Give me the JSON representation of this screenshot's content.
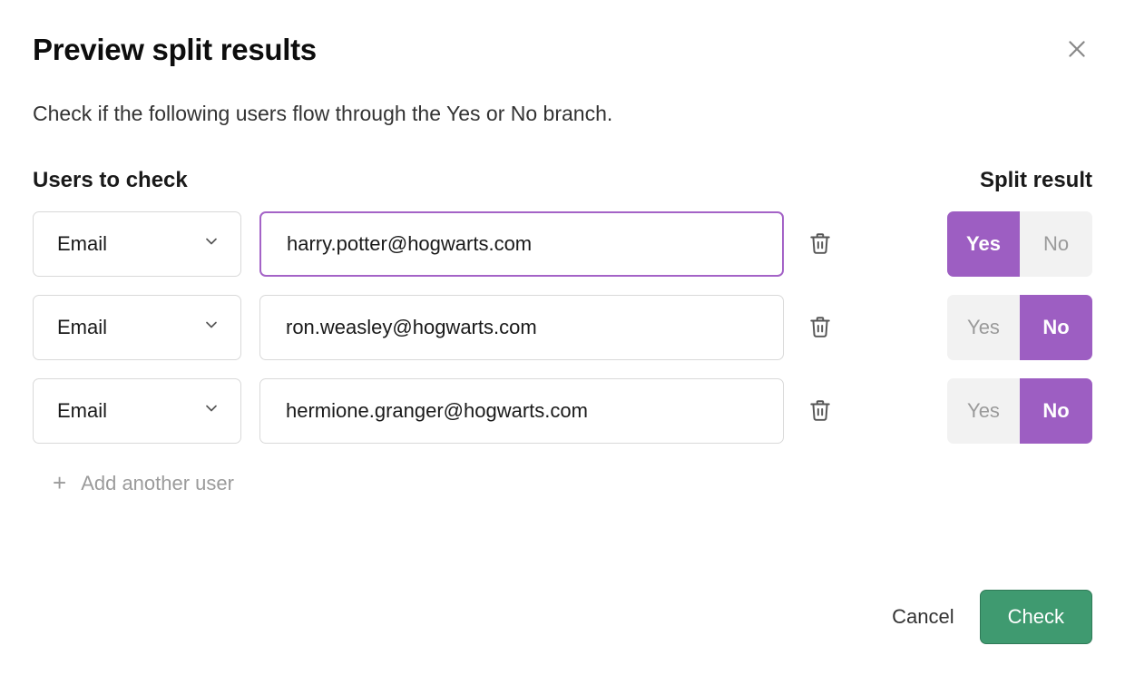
{
  "header": {
    "title": "Preview split results"
  },
  "subtitle": "Check if the following users flow through the Yes or No branch.",
  "labels": {
    "users_to_check": "Users to check",
    "split_result": "Split result"
  },
  "result_labels": {
    "yes": "Yes",
    "no": "No"
  },
  "rows": [
    {
      "type_label": "Email",
      "value": "harry.potter@hogwarts.com",
      "result": "yes",
      "focused": true
    },
    {
      "type_label": "Email",
      "value": "ron.weasley@hogwarts.com",
      "result": "no",
      "focused": false
    },
    {
      "type_label": "Email",
      "value": "hermione.granger@hogwarts.com",
      "result": "no",
      "focused": false
    }
  ],
  "add_user_label": "Add another user",
  "footer": {
    "cancel": "Cancel",
    "check": "Check"
  },
  "colors": {
    "accent_purple": "#9d5ec2",
    "accent_green": "#3f9a70"
  }
}
